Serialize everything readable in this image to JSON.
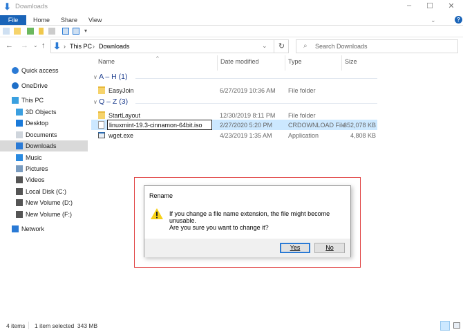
{
  "window": {
    "title": "Downloads",
    "minimize": "–",
    "maximize": "☐",
    "close": "✕"
  },
  "ribbon": {
    "tabs": [
      "File",
      "Home",
      "Share",
      "View"
    ],
    "expand": "⌄",
    "help": "?"
  },
  "address": {
    "back": "←",
    "forward": "→",
    "recent": "⌄",
    "up": "↑",
    "crumbs": [
      "This PC",
      "Downloads"
    ],
    "sep": "›",
    "refresh": "↻",
    "dropdown": "⌄"
  },
  "search": {
    "placeholder": "Search Downloads"
  },
  "nav": {
    "items": [
      {
        "label": "Quick access",
        "icon": "star-icon",
        "color": "#2a7ad5"
      },
      {
        "label": "OneDrive",
        "icon": "cloud-icon",
        "color": "#1e6fc8"
      },
      {
        "label": "This PC",
        "icon": "computer-icon",
        "color": "#3aa0e0"
      },
      {
        "label": "3D Objects",
        "icon": "cube-icon",
        "color": "#3b9fe0"
      },
      {
        "label": "Desktop",
        "icon": "desktop-icon",
        "color": "#1a7ad9"
      },
      {
        "label": "Documents",
        "icon": "document-icon",
        "color": "#cfd5dc"
      },
      {
        "label": "Downloads",
        "icon": "download-icon",
        "color": "#2a7ad5"
      },
      {
        "label": "Music",
        "icon": "music-icon",
        "color": "#2a8ae0"
      },
      {
        "label": "Pictures",
        "icon": "picture-icon",
        "color": "#7a9cc0"
      },
      {
        "label": "Videos",
        "icon": "video-icon",
        "color": "#555"
      },
      {
        "label": "Local Disk (C:)",
        "icon": "drive-icon",
        "color": "#555"
      },
      {
        "label": "New Volume (D:)",
        "icon": "drive-icon",
        "color": "#555"
      },
      {
        "label": "New Volume (F:)",
        "icon": "drive-icon",
        "color": "#555"
      },
      {
        "label": "Network",
        "icon": "network-icon",
        "color": "#2a7ad5"
      }
    ],
    "selected": "Downloads"
  },
  "columns": {
    "name": "Name",
    "date": "Date modified",
    "type": "Type",
    "size": "Size",
    "sort": "^"
  },
  "groups": [
    {
      "label": "A – H (1)",
      "files": [
        {
          "name": "EasyJoin",
          "date": "6/27/2019 10:36 AM",
          "type": "File folder",
          "size": ""
        }
      ]
    },
    {
      "label": "Q – Z (3)",
      "files": [
        {
          "name": "StartLayout",
          "date": "12/30/2019 8:11 PM",
          "type": "File folder",
          "size": ""
        },
        {
          "name": "linuxmint-19.3-cinnamon-64bit.iso",
          "date": "2/27/2020 5:20 PM",
          "type": "CRDOWNLOAD File",
          "size": "352,078 KB"
        },
        {
          "name": "wget.exe",
          "date": "4/23/2019 1:35 AM",
          "type": "Application",
          "size": "4,808 KB"
        }
      ]
    }
  ],
  "dialog": {
    "title": "Rename",
    "message": "If you change a file name extension, the file might become unusable.",
    "question": "Are you sure you want to change it?",
    "yes": "Yes",
    "no": "No"
  },
  "status": {
    "items": "4 items",
    "selected": "1 item selected  343 MB"
  }
}
